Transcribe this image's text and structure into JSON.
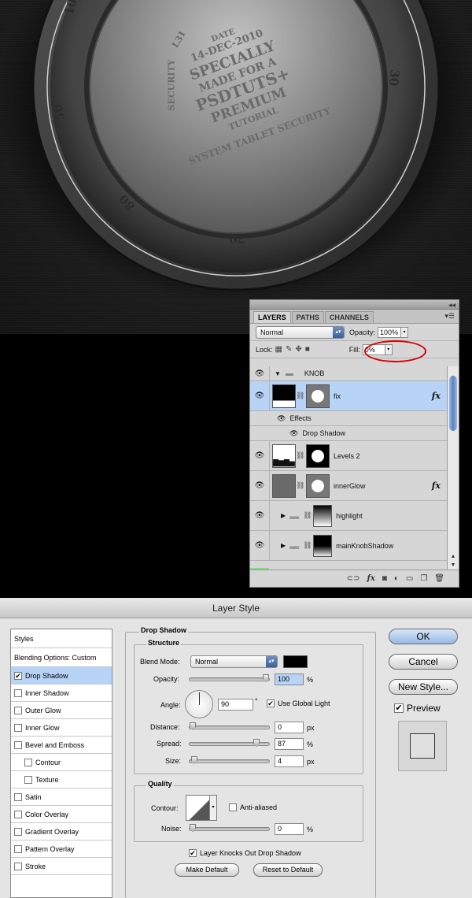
{
  "artwork": {
    "knob_ring_numbers": [
      "10",
      "30",
      "50",
      "80",
      "70"
    ],
    "knob_center_text": [
      "14-DEC-2010",
      "SPECIALLY",
      "MADE FOR A",
      "PSDTUTS+",
      "PREMIUM",
      "TUTORIAL",
      "SYSTEM TABLET SECURITY",
      "SECURITY",
      "DATE",
      "L31"
    ]
  },
  "layers_panel": {
    "collapse_icon": "double-arrow-icon",
    "tabs": [
      {
        "label": "LAYERS",
        "active": true
      },
      {
        "label": "PATHS",
        "active": false
      },
      {
        "label": "CHANNELS",
        "active": false
      }
    ],
    "blend_mode": "Normal",
    "opacity_label": "Opacity:",
    "opacity_value": "100%",
    "lock_label": "Lock:",
    "fill_label": "Fill:",
    "fill_value": "0%",
    "highlight_color": "#d80000",
    "layers": [
      {
        "name": "KNOB",
        "type": "group"
      },
      {
        "name": "fix",
        "type": "layer",
        "selected": true,
        "fx": "fx"
      },
      {
        "name": "Effects",
        "type": "effects"
      },
      {
        "name": "Drop Shadow",
        "type": "effect"
      },
      {
        "name": "Levels 2",
        "type": "adjustment"
      },
      {
        "name": "innerGlow",
        "type": "layer",
        "fx": "fx"
      },
      {
        "name": "highlight",
        "type": "group"
      },
      {
        "name": "mainKnobShadow",
        "type": "group"
      }
    ],
    "footer_icons": [
      "link-icon",
      "fx-icon",
      "mask-icon",
      "adjustment-icon",
      "new-group-icon",
      "new-layer-icon",
      "trash-icon"
    ]
  },
  "layer_style": {
    "title": "Layer Style",
    "styles_header": "Styles",
    "blending_options": "Blending Options: Custom",
    "styles": [
      {
        "label": "Drop Shadow",
        "checked": true,
        "selected": true,
        "indent": false
      },
      {
        "label": "Inner Shadow",
        "checked": false,
        "indent": false
      },
      {
        "label": "Outer Glow",
        "checked": false,
        "indent": false
      },
      {
        "label": "Inner Glow",
        "checked": false,
        "indent": false
      },
      {
        "label": "Bevel and Emboss",
        "checked": false,
        "indent": false
      },
      {
        "label": "Contour",
        "checked": false,
        "indent": true
      },
      {
        "label": "Texture",
        "checked": false,
        "indent": true
      },
      {
        "label": "Satin",
        "checked": false,
        "indent": false
      },
      {
        "label": "Color Overlay",
        "checked": false,
        "indent": false
      },
      {
        "label": "Gradient Overlay",
        "checked": false,
        "indent": false
      },
      {
        "label": "Pattern Overlay",
        "checked": false,
        "indent": false
      },
      {
        "label": "Stroke",
        "checked": false,
        "indent": false
      }
    ],
    "section_title": "Drop Shadow",
    "structure_label": "Structure",
    "blend_mode_label": "Blend Mode:",
    "blend_mode": "Normal",
    "shadow_color": "#000000",
    "opacity_label": "Opacity:",
    "opacity_value": "100",
    "opacity_fraction": 1.0,
    "angle_label": "Angle:",
    "angle_value": "90",
    "angle_unit": "°",
    "use_global_light": "Use Global Light",
    "use_global_light_checked": true,
    "distance_label": "Distance:",
    "distance_value": "0",
    "distance_fraction": 0.0,
    "spread_label": "Spread:",
    "spread_value": "87",
    "spread_fraction": 0.87,
    "size_label": "Size:",
    "size_value": "4",
    "size_fraction": 0.02,
    "px": "px",
    "pct": "%",
    "quality_label": "Quality",
    "contour_label": "Contour:",
    "anti_aliased": "Anti-aliased",
    "anti_aliased_checked": false,
    "noise_label": "Noise:",
    "noise_value": "0",
    "noise_fraction": 0.0,
    "layer_knocks_out": "Layer Knocks Out Drop Shadow",
    "layer_knocks_out_checked": true,
    "make_default": "Make Default",
    "reset_to_default": "Reset to Default",
    "ok": "OK",
    "cancel": "Cancel",
    "new_style": "New Style...",
    "preview": "Preview",
    "preview_checked": true,
    "selection_color": "#b7d3f6"
  }
}
